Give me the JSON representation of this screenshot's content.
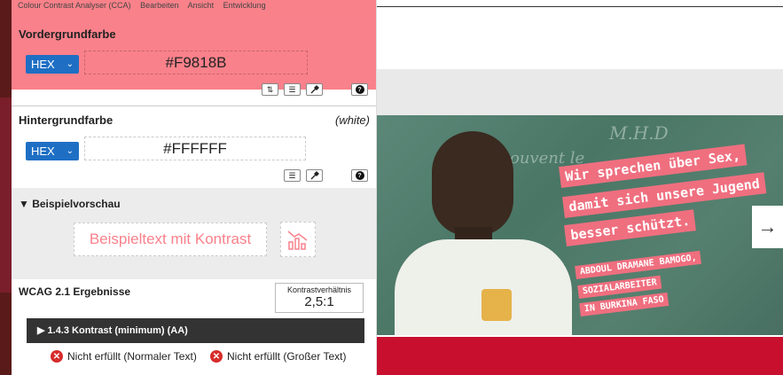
{
  "window": {
    "menu": [
      "Colour Contrast Analyser (CCA)",
      "Bearbeiten",
      "Ansicht",
      "Entwicklung"
    ]
  },
  "foreground": {
    "title": "Vordergrundfarbe",
    "format": "HEX",
    "value": "#F9818B",
    "color": "#F9818B",
    "tools": [
      "swap-icon",
      "sliders-icon",
      "eyedropper-icon",
      "help-icon"
    ]
  },
  "background": {
    "title": "Hintergrundfarbe",
    "color_name": "(white)",
    "format": "HEX",
    "value": "#FFFFFF",
    "tools": [
      "sliders-icon",
      "eyedropper-icon",
      "help-icon"
    ]
  },
  "preview": {
    "title": "▼ Beispielvorschau",
    "sample_text": "Beispieltext mit Kontrast"
  },
  "results": {
    "title": "WCAG 2.1 Ergebnisse",
    "ratio_label": "Kontrastverhältnis",
    "ratio_value": "2,5:1",
    "criterion": "▶ 1.4.3 Kontrast (minimum) (AA)",
    "normal_text": "Nicht erfüllt (Normaler Text)",
    "large_text": "Nicht erfüllt (Großer Text)"
  },
  "website": {
    "hero_tag_1": "Wir sprechen über Sex,",
    "hero_tag_2": "damit sich unsere Jugend",
    "hero_tag_3": "besser schützt.",
    "caption_1": "ABDOUL DRAMANE BAMOGO,",
    "caption_2": "SOZIALARBEITER",
    "caption_3": "IN BURKINA FASO",
    "chalk_1": "M.H.D",
    "chalk_2": "ouvent le",
    "next_arrow": "→"
  },
  "colors": {
    "accent": "#F9818B",
    "select_blue": "#1E6FC4",
    "fail_red": "#D72C2C",
    "site_red": "#C8102E"
  }
}
